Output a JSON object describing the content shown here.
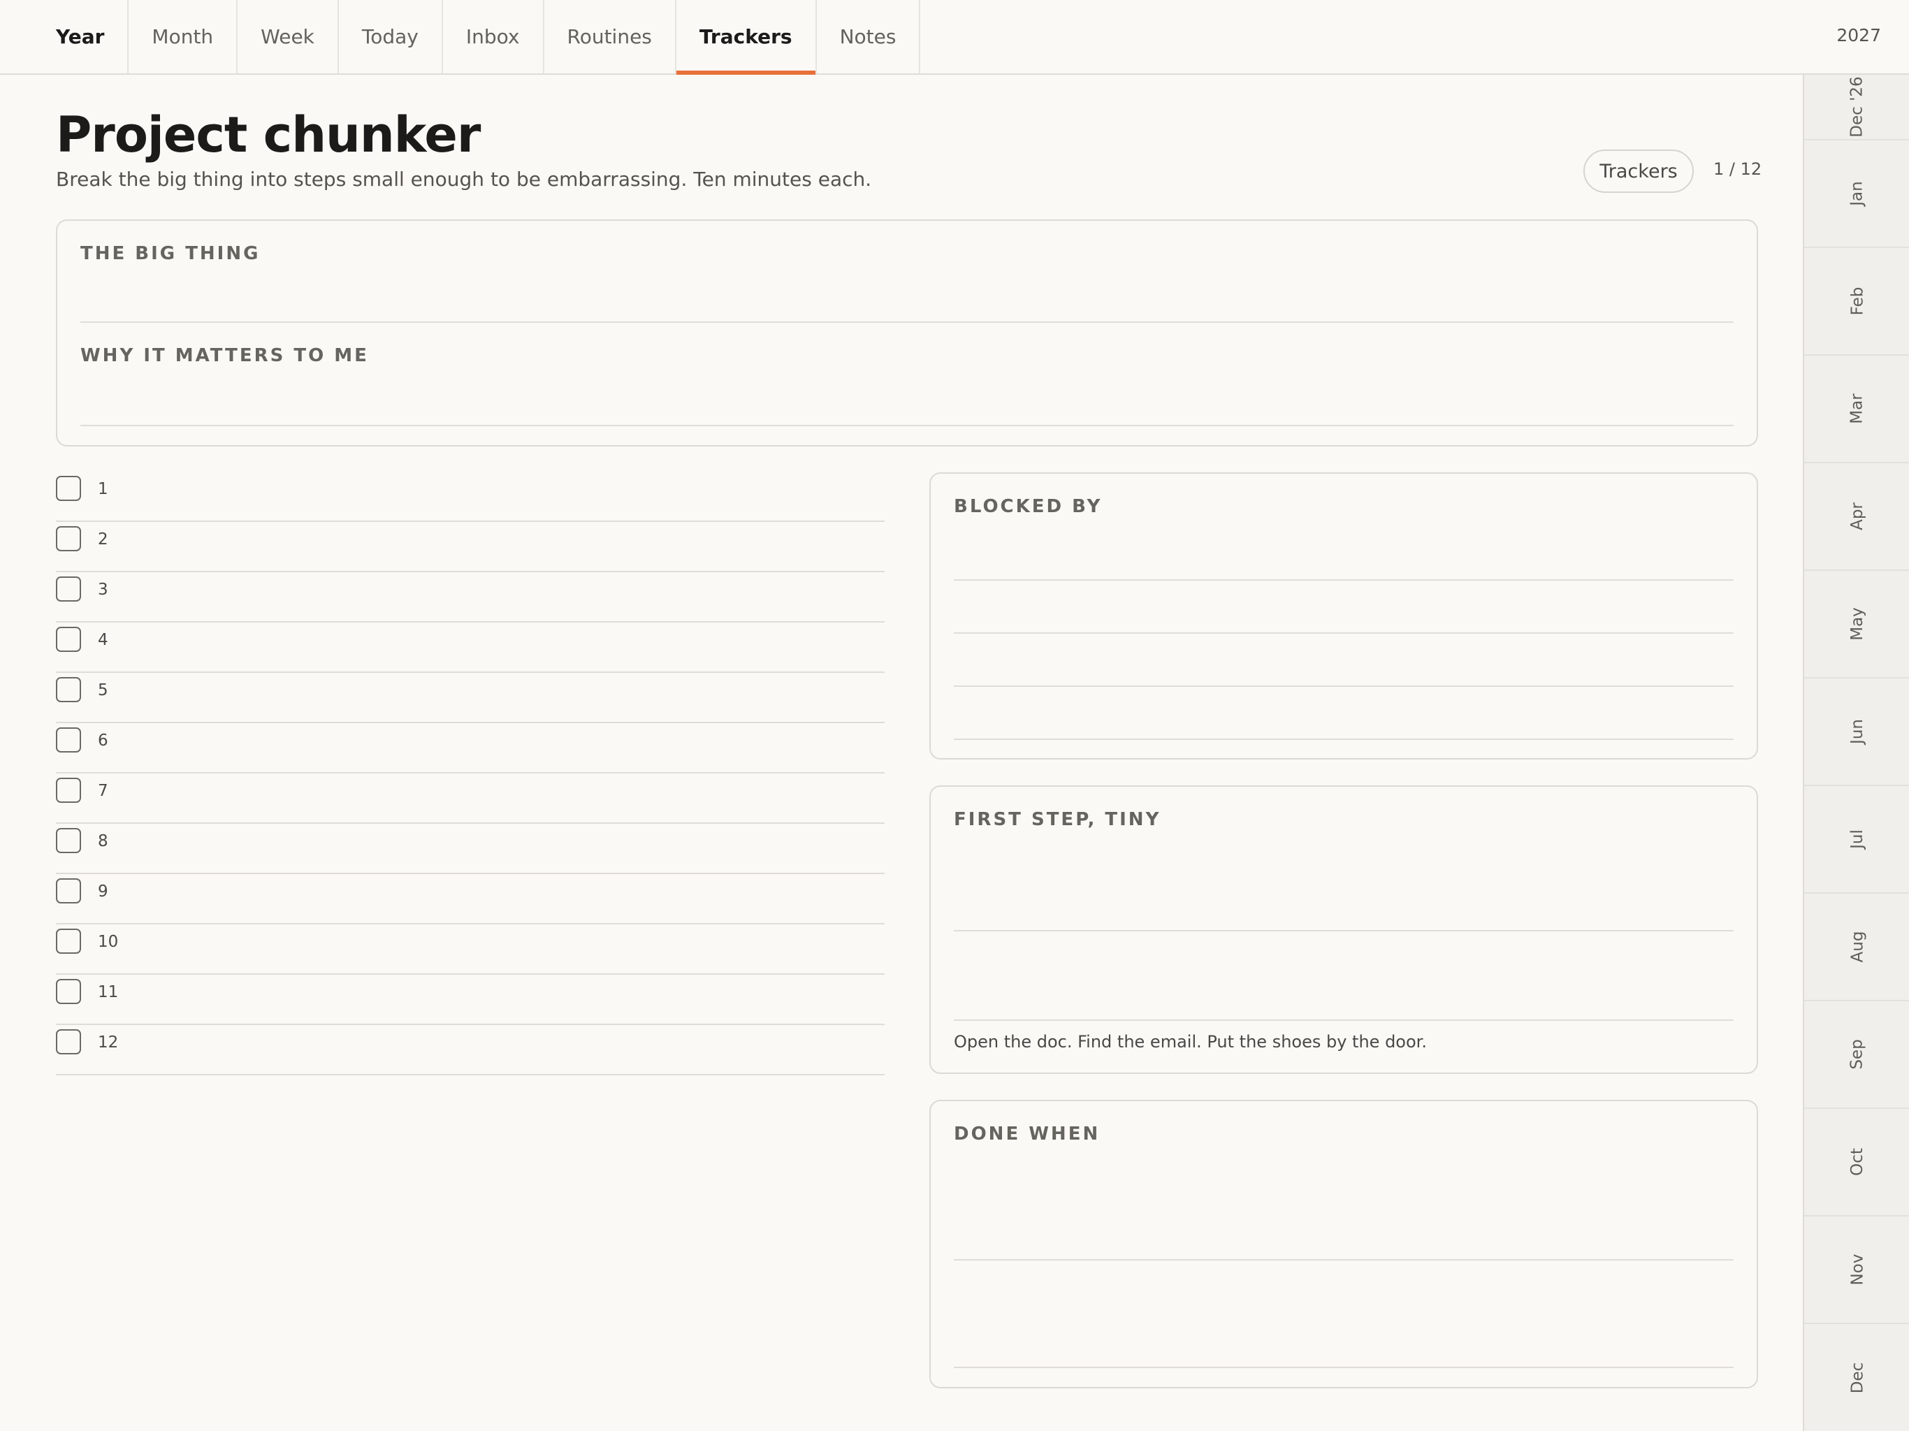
{
  "nav": {
    "tabs": [
      {
        "label": "Year"
      },
      {
        "label": "Month"
      },
      {
        "label": "Week"
      },
      {
        "label": "Today"
      },
      {
        "label": "Inbox"
      },
      {
        "label": "Routines"
      },
      {
        "label": "Trackers"
      },
      {
        "label": "Notes"
      }
    ],
    "active_tab": "Trackers",
    "year": "2027"
  },
  "months_rail": [
    "Dec '26",
    "Jan",
    "Feb",
    "Mar",
    "Apr",
    "May",
    "Jun",
    "Jul",
    "Aug",
    "Sep",
    "Oct",
    "Nov",
    "Dec"
  ],
  "header": {
    "title": "Project chunker",
    "subtitle": "Break the big thing into steps small enough to be embarrassing. Ten minutes each.",
    "trackers_button": "Trackers",
    "page_indicator": "1 / 12"
  },
  "big_thing": {
    "label": "THE BIG THING",
    "why_label": "WHY IT MATTERS TO ME"
  },
  "steps": [
    "1",
    "2",
    "3",
    "4",
    "5",
    "6",
    "7",
    "8",
    "9",
    "10",
    "11",
    "12"
  ],
  "blocked_by": {
    "label": "BLOCKED BY"
  },
  "first_step": {
    "label": "FIRST STEP, TINY",
    "hint": "Open the doc. Find the email. Put the shoes by the door."
  },
  "done_when": {
    "label": "DONE WHEN"
  },
  "colors": {
    "accent": "#e8703a",
    "background": "#faf9f6",
    "rail": "#f0efeb"
  }
}
